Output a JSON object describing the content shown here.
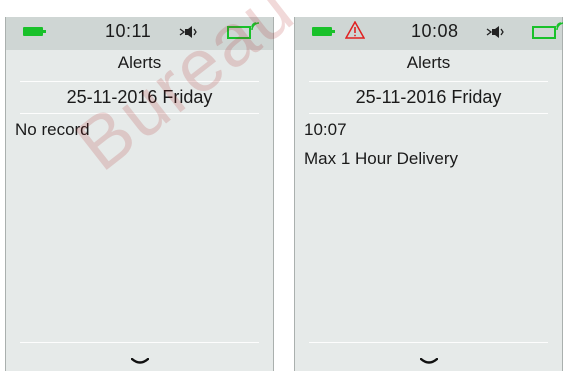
{
  "colors": {
    "screen_bg": "#e6eae9",
    "status_bar_bg": "#cfd6d4",
    "battery_green": "#19c12a",
    "alert_red": "#e02020",
    "watermark_red": "#aa1414"
  },
  "watermark_text": "Bureau Veritas",
  "screens": [
    {
      "status": {
        "time": "10:11",
        "icons": [
          "battery-icon",
          "sound-icon",
          "pump-signal-icon"
        ]
      },
      "title": "Alerts",
      "date_line": "25-11-2016 Friday",
      "records": [
        "No record"
      ],
      "footer_icon": "chevron-down-icon"
    },
    {
      "status": {
        "time": "10:08",
        "icons": [
          "battery-icon",
          "alert-icon",
          "sound-icon",
          "pump-signal-icon"
        ]
      },
      "title": "Alerts",
      "date_line": "25-11-2016 Friday",
      "records": [
        "10:07",
        "Max 1 Hour Delivery"
      ],
      "footer_icon": "chevron-down-icon"
    }
  ]
}
